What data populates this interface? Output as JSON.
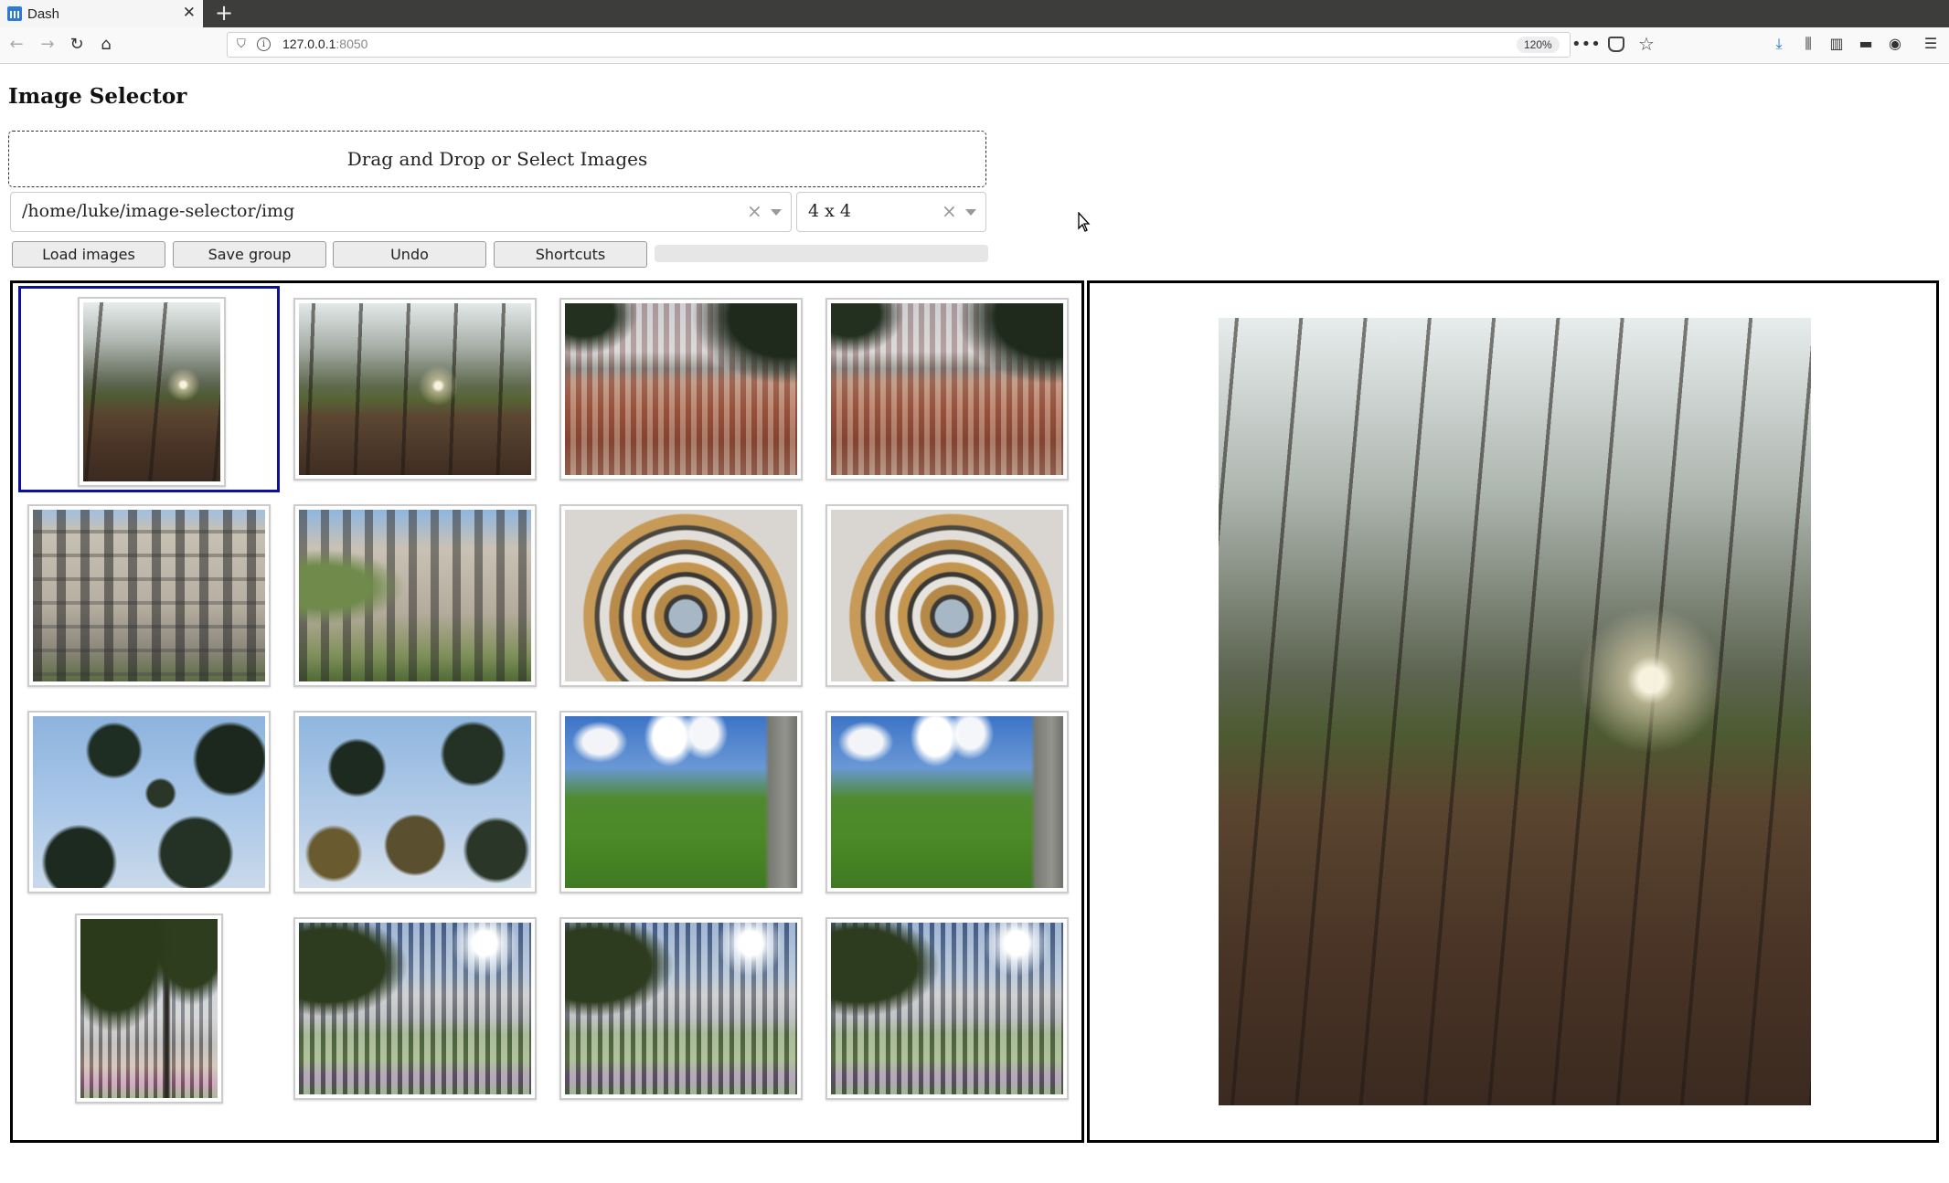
{
  "browser": {
    "tab_title": "Dash",
    "url_host": "127.0.0.1",
    "url_port": ":8050",
    "zoom": "120%"
  },
  "app": {
    "title": "Image Selector",
    "upload_label": "Drag and Drop or Select Images",
    "folder_value": "/home/luke/image-selector/img",
    "grid_value": "4 x 4",
    "buttons": {
      "load": "Load images",
      "save": "Save group",
      "undo": "Undo",
      "shortcuts": "Shortcuts"
    },
    "progress": 0,
    "selected_index": 0,
    "colors": {
      "selected_border": "#0d0f9e",
      "panel_border": "#000000"
    },
    "thumbnails": [
      {
        "subject": "autumn-park",
        "orientation": "portrait"
      },
      {
        "subject": "autumn-park",
        "orientation": "landscape"
      },
      {
        "subject": "town-rooftops",
        "orientation": "landscape"
      },
      {
        "subject": "town-rooftops",
        "orientation": "landscape"
      },
      {
        "subject": "colosseum",
        "orientation": "landscape"
      },
      {
        "subject": "colosseum",
        "orientation": "landscape"
      },
      {
        "subject": "spiral-staircase",
        "orientation": "landscape"
      },
      {
        "subject": "spiral-staircase",
        "orientation": "landscape"
      },
      {
        "subject": "pine-trees",
        "orientation": "landscape"
      },
      {
        "subject": "pine-trees",
        "orientation": "landscape"
      },
      {
        "subject": "green-hill",
        "orientation": "landscape"
      },
      {
        "subject": "green-hill",
        "orientation": "landscape"
      },
      {
        "subject": "palace",
        "orientation": "portrait"
      },
      {
        "subject": "palace",
        "orientation": "landscape"
      },
      {
        "subject": "palace",
        "orientation": "landscape"
      },
      {
        "subject": "palace",
        "orientation": "landscape"
      }
    ],
    "preview": {
      "subject": "autumn-park"
    }
  }
}
